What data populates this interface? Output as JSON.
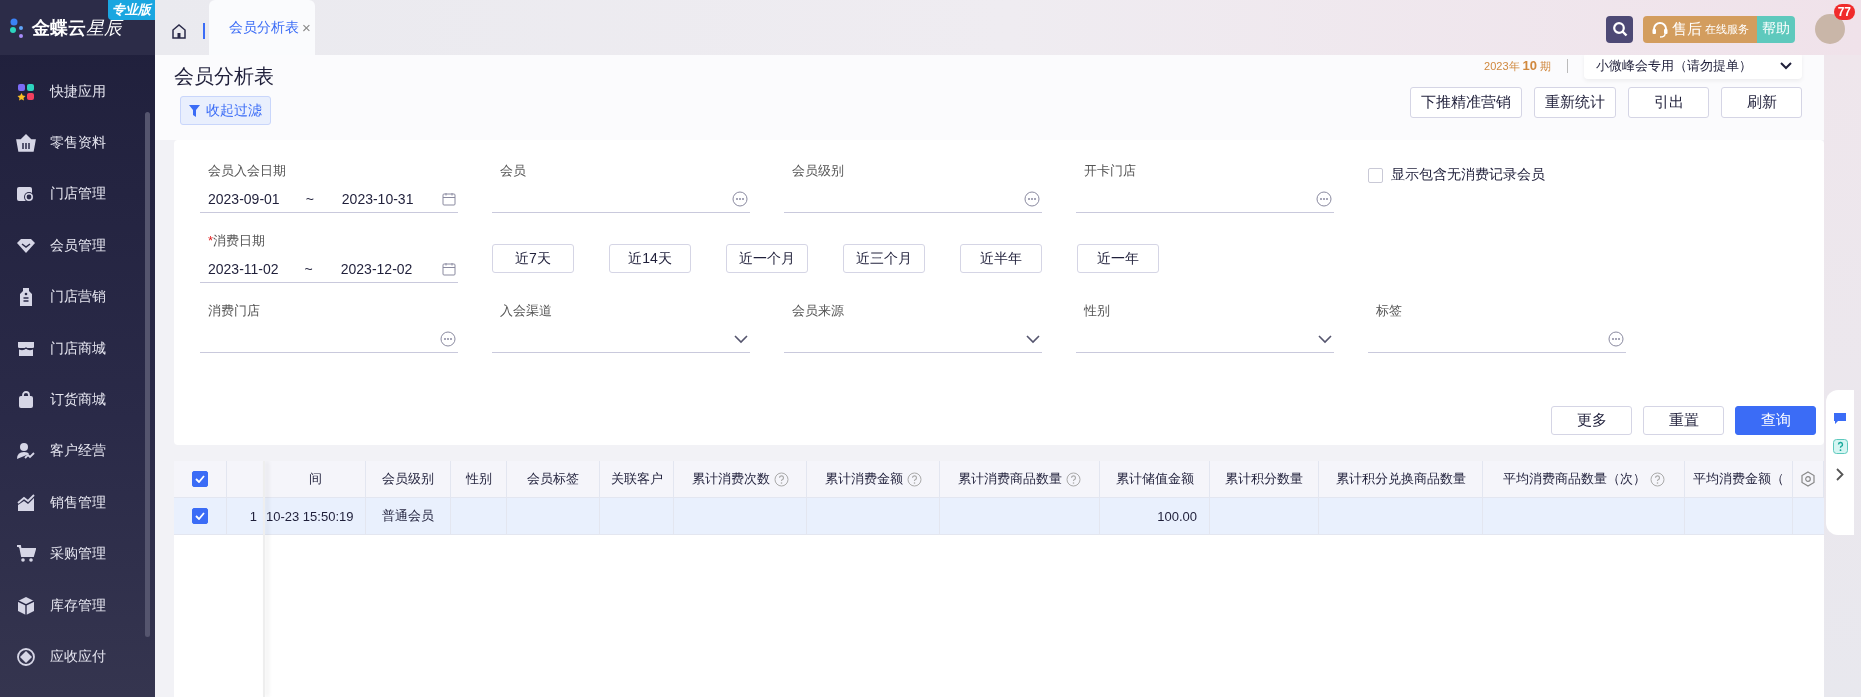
{
  "brand": {
    "name": "金蝶云",
    "sub": "星辰",
    "edition": "专业版"
  },
  "sidebar": {
    "items": [
      {
        "label": "快捷应用"
      },
      {
        "label": "零售资料"
      },
      {
        "label": "门店管理"
      },
      {
        "label": "会员管理"
      },
      {
        "label": "门店营销"
      },
      {
        "label": "门店商城"
      },
      {
        "label": "订货商城"
      },
      {
        "label": "客户经营"
      },
      {
        "label": "销售管理"
      },
      {
        "label": "采购管理"
      },
      {
        "label": "库存管理"
      },
      {
        "label": "应收应付"
      }
    ]
  },
  "tabs": [
    {
      "label": "会员分析表",
      "close": "×",
      "selected": true
    }
  ],
  "topbar": {
    "service": {
      "main": "售后",
      "sub": "在线服务"
    },
    "help": "帮助",
    "notifications": "77"
  },
  "page": {
    "title": "会员分析表",
    "filter_toggle": "收起过滤",
    "period": {
      "year": "2023年",
      "number": "10",
      "unit": "期"
    },
    "org": "小微峰会专用（请勿提单）",
    "actions": [
      "下推精准营销",
      "重新统计",
      "引出",
      "刷新"
    ]
  },
  "filters": {
    "rows": [
      {
        "fields": [
          {
            "kind": "date_range",
            "label": "会员入会日期",
            "from": "2023-09-01",
            "sep": "~",
            "to": "2023-10-31"
          },
          {
            "kind": "lookup",
            "label": "会员"
          },
          {
            "kind": "lookup",
            "label": "会员级别"
          },
          {
            "kind": "lookup",
            "label": "开卡门店"
          },
          {
            "kind": "checkbox",
            "label": "显示包含无消费记录会员",
            "checked": false
          }
        ]
      },
      {
        "fields": [
          {
            "kind": "date_range",
            "label": "消费日期",
            "required_mark": "*",
            "from": "2023-11-02",
            "sep": "~",
            "to": "2023-12-02"
          }
        ],
        "quick": [
          "近7天",
          "近14天",
          "近一个月",
          "近三个月",
          "近半年",
          "近一年"
        ]
      },
      {
        "fields": [
          {
            "kind": "lookup",
            "label": "消费门店"
          },
          {
            "kind": "select",
            "label": "入会渠道"
          },
          {
            "kind": "select",
            "label": "会员来源"
          },
          {
            "kind": "select",
            "label": "性别"
          },
          {
            "kind": "lookup",
            "label": "标签"
          }
        ]
      }
    ],
    "buttons": [
      {
        "label": "更多",
        "primary": false
      },
      {
        "label": "重置",
        "primary": false
      },
      {
        "label": "查询",
        "primary": true
      }
    ]
  },
  "table": {
    "all_checked": true,
    "columns": [
      {
        "label": "间",
        "help": false
      },
      {
        "label": "会员级别",
        "help": false
      },
      {
        "label": "性别",
        "help": false
      },
      {
        "label": "会员标签",
        "help": false
      },
      {
        "label": "关联客户",
        "help": false
      },
      {
        "label": "累计消费次数",
        "help": true
      },
      {
        "label": "累计消费金额",
        "help": true
      },
      {
        "label": "累计消费商品数量",
        "help": true
      },
      {
        "label": "累计储值金额",
        "help": false
      },
      {
        "label": "累计积分数量",
        "help": false
      },
      {
        "label": "累计积分兑换商品数量",
        "help": false
      },
      {
        "label": "平均消费商品数量（次）",
        "help": true
      },
      {
        "label": "平均消费金额（",
        "help": false
      }
    ],
    "rows": [
      {
        "selected": true,
        "index": "1",
        "cells": [
          "10-23 15:50:19",
          "普通会员",
          null,
          null,
          null,
          null,
          null,
          null,
          "100.00",
          null,
          null,
          null,
          null
        ]
      }
    ]
  }
}
